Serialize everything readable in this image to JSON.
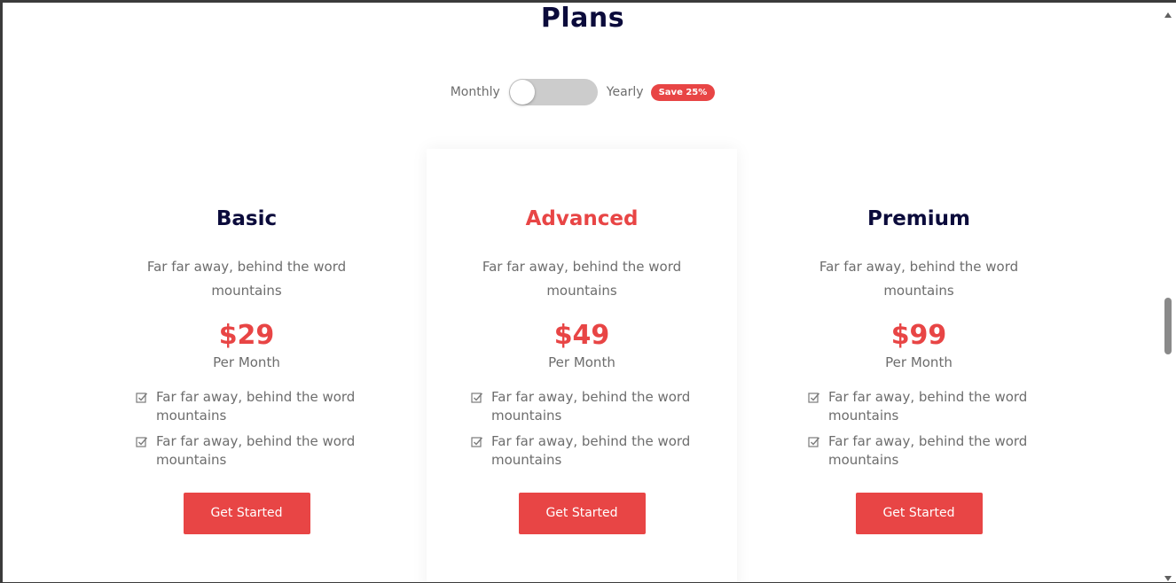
{
  "header": {
    "title": "Plans"
  },
  "billing_toggle": {
    "monthly_label": "Monthly",
    "yearly_label": "Yearly",
    "badge": "Save 25%"
  },
  "plans": [
    {
      "name": "Basic",
      "description": "Far far away, behind the word mountains",
      "price": "$29",
      "period": "Per Month",
      "features": [
        "Far far away, behind the word mountains",
        "Far far away, behind the word mountains"
      ],
      "button": "Get Started"
    },
    {
      "name": "Advanced",
      "description": "Far far away, behind the word mountains",
      "price": "$49",
      "period": "Per Month",
      "features": [
        "Far far away, behind the word mountains",
        "Far far away, behind the word mountains"
      ],
      "button": "Get Started"
    },
    {
      "name": "Premium",
      "description": "Far far away, behind the word mountains",
      "price": "$99",
      "period": "Per Month",
      "features": [
        "Far far away, behind the word mountains",
        "Far far away, behind the word mountains"
      ],
      "button": "Get Started"
    }
  ],
  "colors": {
    "accent": "#e84545",
    "heading": "#0b0b3b",
    "text": "#6d6d6d"
  },
  "icons": {
    "feature": "checkbox-check-icon"
  }
}
